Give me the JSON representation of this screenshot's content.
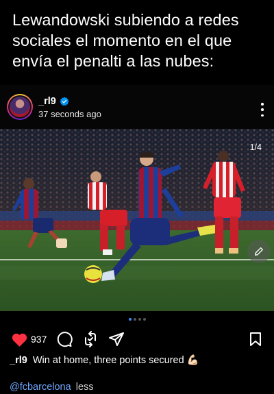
{
  "meme": {
    "caption_line1": "Lewandowski subiendo a redes",
    "caption_line2": "sociales el momento en el que",
    "caption_line3": "envía el penalti a las nubes:"
  },
  "post": {
    "username": "_rl9",
    "timestamp": "37 seconds ago",
    "image_counter": "1/4",
    "carousel": {
      "count": 4,
      "active_index": 0
    },
    "likes": "937",
    "caption_user": "_rl9",
    "caption_text": "Win at home, three points secured 💪🏻",
    "mention": "@fcbarcelona",
    "less_label": "less"
  },
  "colors": {
    "accent_blue": "#3a8eff",
    "like_red": "#ff3040",
    "verified_blue": "#0095f6"
  },
  "icons": {
    "like": "heart-icon",
    "comment": "comment-icon",
    "repost": "repost-icon",
    "share": "share-icon",
    "save": "bookmark-icon",
    "more": "more-vertical-icon",
    "edit": "pencil-icon"
  }
}
